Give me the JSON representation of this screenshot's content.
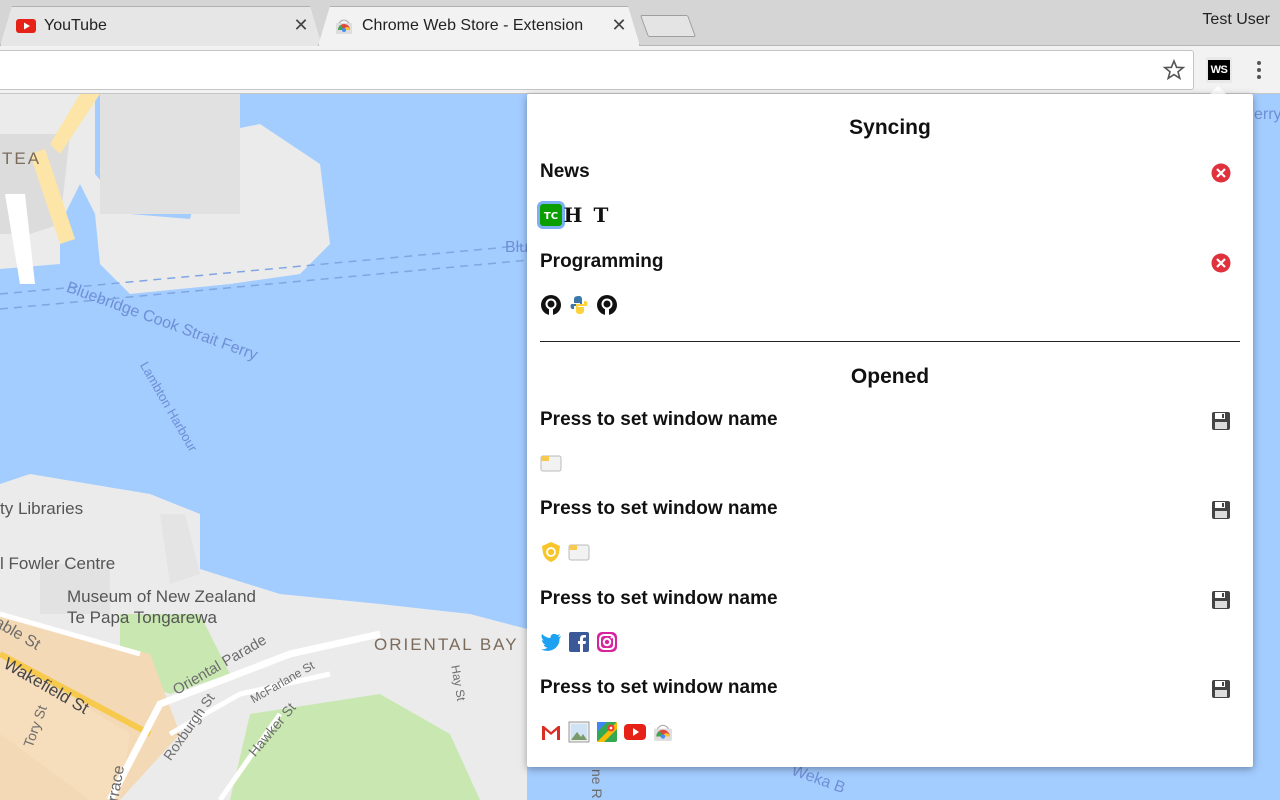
{
  "browser": {
    "tabs": [
      {
        "title": "YouTube",
        "favicon": "youtube-icon",
        "active": false
      },
      {
        "title": "Chrome Web Store - Extension",
        "favicon": "chrome-web-store-icon",
        "active": true
      }
    ],
    "profile_name": "Test User",
    "extension_button": "WS"
  },
  "map": {
    "labels": {
      "libraries": "ty Libraries",
      "fowler": "l Fowler Centre",
      "museum1": "Museum of New Zealand",
      "museum2": "Te Papa Tongarewa",
      "oriental_bay": "ORIENTAL BAY",
      "ferry": "Bluebridge Cook Strait Ferry",
      "lambton": "Lambton Harbour",
      "tea": "TEA",
      "oriental_parade": "Oriental Parade",
      "wakefield": "Wakefield St",
      "cable": "able St",
      "roxburgh": "Roxburgh St",
      "mcfarlane": "McFarlane St",
      "hawker": "Hawker St",
      "hay": "Hay St",
      "tory": "Tory St",
      "terrace": "rrace",
      "weka": "Weka B",
      "blu": "Blu",
      "erry": "erry",
      "nero": "ne R"
    }
  },
  "popup": {
    "syncing": {
      "title": "Syncing",
      "groups": [
        {
          "name": "News",
          "action_icon": "close-circle-icon",
          "favicons": [
            "techcrunch-icon",
            "huffpost-icon",
            "nytimes-icon"
          ]
        },
        {
          "name": "Programming",
          "action_icon": "close-circle-icon",
          "favicons": [
            "github-icon",
            "python-icon",
            "github-icon"
          ]
        }
      ]
    },
    "opened": {
      "title": "Opened",
      "windows": [
        {
          "name": "Press to set window name",
          "action_icon": "floppy-save-icon",
          "favicons": [
            "default-page-icon"
          ]
        },
        {
          "name": "Press to set window name",
          "action_icon": "floppy-save-icon",
          "favicons": [
            "shield-icon",
            "default-page-icon"
          ]
        },
        {
          "name": "Press to set window name",
          "action_icon": "floppy-save-icon",
          "favicons": [
            "twitter-icon",
            "facebook-icon",
            "instagram-icon"
          ]
        },
        {
          "name": "Press to set window name",
          "action_icon": "floppy-save-icon",
          "favicons": [
            "gmail-icon",
            "photos-icon",
            "google-maps-icon",
            "youtube-icon",
            "chrome-web-store-icon"
          ]
        }
      ]
    }
  },
  "colors": {
    "water": "#a3ccff",
    "land": "#ebebeb",
    "park": "#c9e8b1",
    "remove": "#e0323c"
  }
}
